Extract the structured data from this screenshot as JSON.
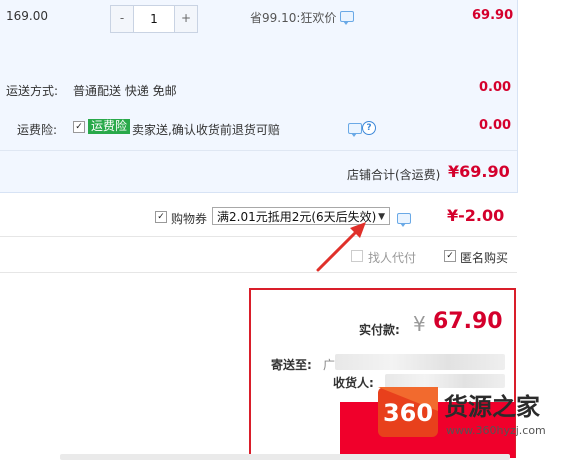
{
  "item": {
    "price": "169.00",
    "quantity": "1",
    "minus": "-",
    "plus": "+",
    "discount": "省99.10:狂欢价",
    "subtotal": "69.90"
  },
  "shipping": {
    "label": "运送方式:",
    "value": "普通配送 快递 免邮",
    "amount": "0.00"
  },
  "insurance": {
    "label": "运费险:",
    "badge": "运费险",
    "desc": "卖家送,确认收货前退货可赔",
    "amount": "0.00",
    "help": "?"
  },
  "store_total": {
    "label": "店铺合计(含运费)",
    "amount": "¥69.90"
  },
  "coupon": {
    "label": "购物券",
    "selected": "满2.01元抵用2元(6天后失效)",
    "arrow": "▼",
    "amount": "¥-2.00"
  },
  "options": {
    "find_payer": "找人代付",
    "anonymous": "匿名购买"
  },
  "payment": {
    "label": "实付款:",
    "currency": "¥",
    "amount": "67.90",
    "ship_to_label": "寄送至:",
    "ship_to_prefix": "广",
    "receiver_label": "收货人:"
  },
  "watermark": {
    "number": "360",
    "name": "货源之家",
    "url": "www.360hyzj.com"
  },
  "colors": {
    "accent_red": "#d4002c",
    "panel_blue": "#f2f7ff",
    "arrow_red": "#e0302a",
    "badge_green": "#29a94a"
  }
}
